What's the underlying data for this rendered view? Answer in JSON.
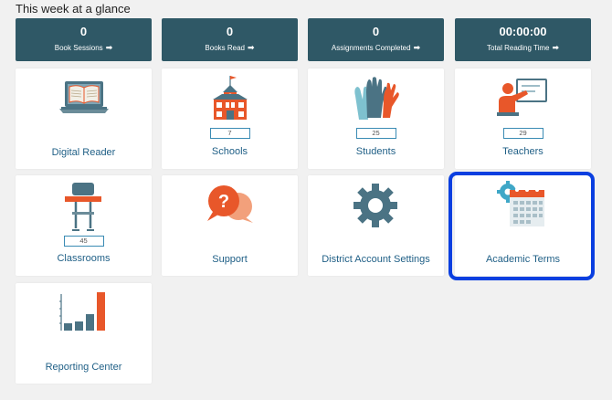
{
  "heading": "This week at a glance",
  "stats": [
    {
      "value": "0",
      "label": "Book Sessions"
    },
    {
      "value": "0",
      "label": "Books Read"
    },
    {
      "value": "0",
      "label": "Assignments Completed"
    },
    {
      "value": "00:00:00",
      "label": "Total Reading Time"
    }
  ],
  "cards": {
    "digital_reader": {
      "title": "Digital Reader"
    },
    "schools": {
      "title": "Schools",
      "count": "7"
    },
    "students": {
      "title": "Students",
      "count": "25"
    },
    "teachers": {
      "title": "Teachers",
      "count": "29"
    },
    "classrooms": {
      "title": "Classrooms",
      "count": "45"
    },
    "support": {
      "title": "Support"
    },
    "district_settings": {
      "title": "District Account Settings"
    },
    "academic_terms": {
      "title": "Academic Terms"
    },
    "reporting_center": {
      "title": "Reporting Center"
    }
  },
  "icons": {
    "book_sessions_arrow": "arrow-right-icon",
    "laptop": "laptop-book-icon",
    "school": "school-building-icon",
    "hands": "raised-hands-icon",
    "teacher": "teacher-board-icon",
    "desk": "classroom-desk-icon",
    "support": "question-speech-bubbles-icon",
    "gear": "gear-icon",
    "calendar": "calendar-gear-icon",
    "chart": "bar-chart-icon"
  },
  "colors": {
    "stat_bg": "#2f5866",
    "accent_orange": "#e8572a",
    "title_blue": "#1f5f86",
    "selection_blue": "#0a3fe0",
    "slate": "#4b7384"
  }
}
